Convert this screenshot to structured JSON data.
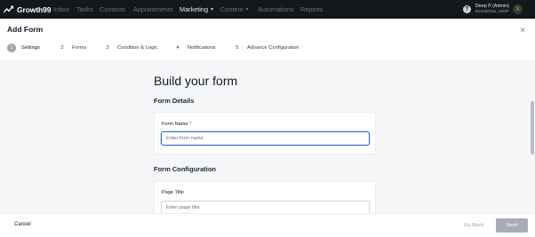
{
  "app": {
    "brand": "Growth99"
  },
  "nav": {
    "items": [
      {
        "label": "Inbox",
        "active": false,
        "dropdown": false
      },
      {
        "label": "Tasks",
        "active": false,
        "dropdown": false
      },
      {
        "label": "Contacts",
        "active": false,
        "dropdown": false
      },
      {
        "label": "Appointments",
        "active": false,
        "dropdown": false
      },
      {
        "label": "Marketing",
        "active": true,
        "dropdown": true
      },
      {
        "label": "Content",
        "active": false,
        "dropdown": true
      },
      {
        "label": "Automations",
        "active": false,
        "dropdown": false
      },
      {
        "label": "Reports",
        "active": false,
        "dropdown": false
      }
    ],
    "user": {
      "name": "Deep P (Admin)",
      "subtitle": "DentalGlow_refelF",
      "avatar_initial": "X"
    },
    "help_glyph": "?"
  },
  "header": {
    "title": "Add Form",
    "close_glyph": "×",
    "steps": [
      {
        "number": "1",
        "label": "Settings",
        "active": true
      },
      {
        "number": "2",
        "label": "Forms",
        "active": false
      },
      {
        "number": "3",
        "label": "Condition & Logic",
        "active": false
      },
      {
        "number": "4",
        "label": "Notifications",
        "active": false
      },
      {
        "number": "5",
        "label": "Advance Configuration",
        "active": false
      }
    ]
  },
  "main": {
    "heading": "Build your form",
    "form_details": {
      "section_title": "Form Details",
      "form_name_label": "Form Name",
      "required_mark": "*",
      "form_name_value": "",
      "form_name_placeholder": "Enter form name"
    },
    "form_configuration": {
      "section_title": "Form Configuration",
      "page_title_label": "Page Title",
      "page_title_value": "",
      "page_title_placeholder": "Enter page title"
    }
  },
  "footer": {
    "cancel_label": "Cancel",
    "go_back_label": "Go Back",
    "next_label": "Next"
  },
  "colors": {
    "topnav_bg": "#14171c",
    "page_bg": "#f5f6f7",
    "active_step": "#9ca3af",
    "focus_border": "#2563eb",
    "next_button": "#a8adb5"
  }
}
